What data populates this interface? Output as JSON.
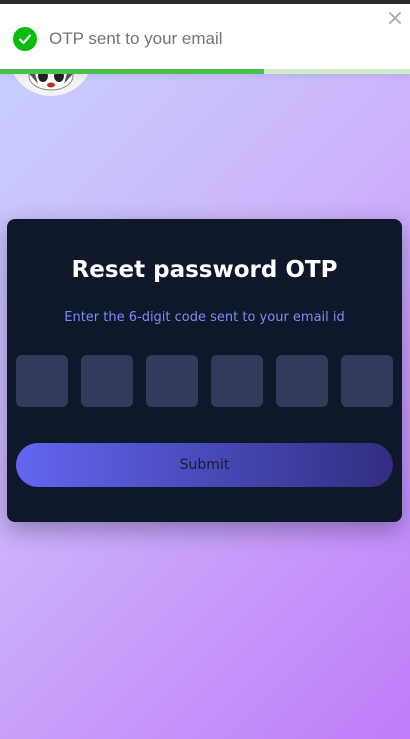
{
  "toast": {
    "message": "OTP sent to your email",
    "icon": "check-circle-icon",
    "close_icon": "close-icon",
    "progress_fraction": 0.645,
    "color_success": "#07bc0c",
    "color_progress": "#4cc04e"
  },
  "header": {
    "logo_icon": "logo-mascot-icon"
  },
  "form": {
    "title": "Reset password OTP",
    "subtitle": "Enter the 6-digit code sent to your email id",
    "otp_digits": [
      "",
      "",
      "",
      "",
      "",
      ""
    ],
    "submit_label": "Submit",
    "color_card": "#0f172a",
    "color_accent": "#818cf8"
  }
}
